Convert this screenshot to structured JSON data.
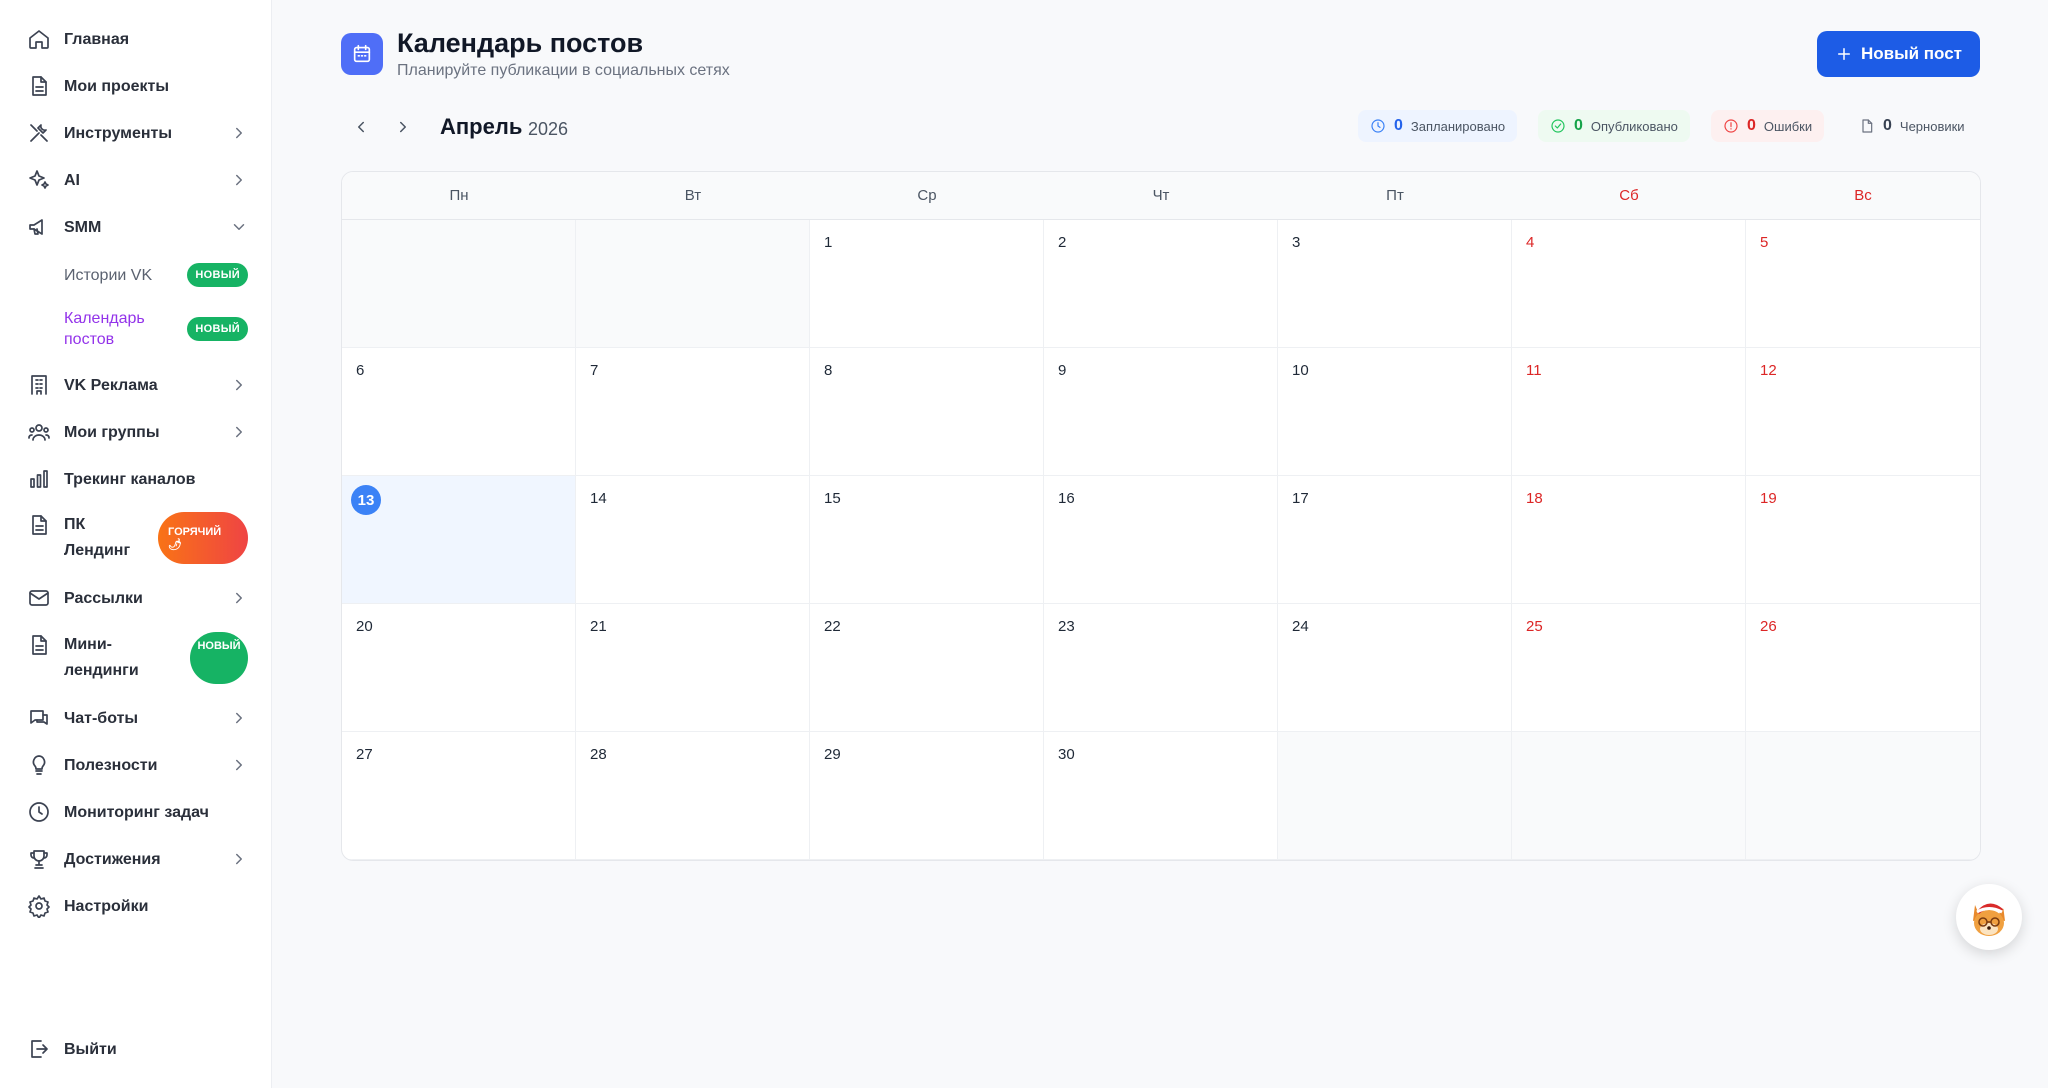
{
  "sidebar": {
    "items": [
      {
        "label": "Главная"
      },
      {
        "label": "Мои проекты"
      },
      {
        "label": "Инструменты"
      },
      {
        "label": "AI"
      },
      {
        "label": "SMM"
      },
      {
        "label": "VK Реклама"
      },
      {
        "label": "Мои группы"
      },
      {
        "label": "Трекинг каналов"
      },
      {
        "label": "ПК\nЛендинг"
      },
      {
        "label": "Рассылки"
      },
      {
        "label": "Мини-\nлендинги"
      },
      {
        "label": "Чат-боты"
      },
      {
        "label": "Полезности"
      },
      {
        "label": "Мониторинг задач"
      },
      {
        "label": "Достижения"
      },
      {
        "label": "Настройки"
      }
    ],
    "sub_items": [
      {
        "label": "Истории VK",
        "badge": "НОВЫЙ"
      },
      {
        "label": "Календарь\nпостов",
        "badge": "НОВЫЙ"
      }
    ],
    "hot_badge": "ГОРЯЧИЙ 🌶",
    "new_badge": "НОВЫЙ",
    "logout": "Выйти"
  },
  "header": {
    "title": "Календарь постов",
    "subtitle": "Планируйте публикации в социальных сетях",
    "new_post_label": "Новый пост"
  },
  "calendar": {
    "month": "Апрель",
    "year": "2026",
    "weekdays": [
      "Пн",
      "Вт",
      "Ср",
      "Чт",
      "Пт",
      "Сб",
      "Вс"
    ],
    "today": 13,
    "days": [
      "",
      "",
      "1",
      "2",
      "3",
      "4",
      "5",
      "6",
      "7",
      "8",
      "9",
      "10",
      "11",
      "12",
      "13",
      "14",
      "15",
      "16",
      "17",
      "18",
      "19",
      "20",
      "21",
      "22",
      "23",
      "24",
      "25",
      "26",
      "27",
      "28",
      "29",
      "30",
      "",
      "",
      ""
    ]
  },
  "stats": {
    "planned": {
      "count": "0",
      "label": "Запланировано"
    },
    "published": {
      "count": "0",
      "label": "Опубликовано"
    },
    "errors": {
      "count": "0",
      "label": "Ошибки"
    },
    "drafts": {
      "count": "0",
      "label": "Черновики"
    }
  },
  "colors": {
    "accent": "#1d5ce6",
    "today": "#3b82f6",
    "weekend": "#dc2626",
    "badge_new": "#16b364",
    "active_sub": "#9333ea"
  }
}
